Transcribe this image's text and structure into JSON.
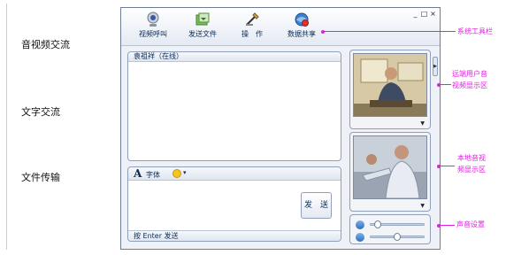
{
  "left_labels": [
    "音视频交流",
    "文字交流",
    "文件传输"
  ],
  "toolbar": {
    "items": [
      {
        "label": "视频呼叫",
        "icon": "webcam-icon"
      },
      {
        "label": "发送文件",
        "icon": "send-file-icon"
      },
      {
        "label": "操　作",
        "icon": "operation-icon"
      },
      {
        "label": "数据共享",
        "icon": "data-share-icon"
      }
    ],
    "window_controls": [
      "_",
      "□",
      "×"
    ]
  },
  "chat": {
    "header": "袁祖祥（在线）"
  },
  "input": {
    "font_label": "字体",
    "send_label": "发　送",
    "hint": "按 Enter 发送"
  },
  "sound": {
    "volume_speaker": 0.08,
    "volume_mic": 0.48
  },
  "annotations": {
    "toolbar": "系统工具栏",
    "remote_video": [
      "远端用户音",
      "视频显示区"
    ],
    "local_video": [
      "本地音视",
      "频显示区"
    ],
    "sound": "声音设置"
  },
  "colors": {
    "annotation": "#e020e0",
    "window_border": "#6c7d96",
    "text": "#0b2a55"
  }
}
